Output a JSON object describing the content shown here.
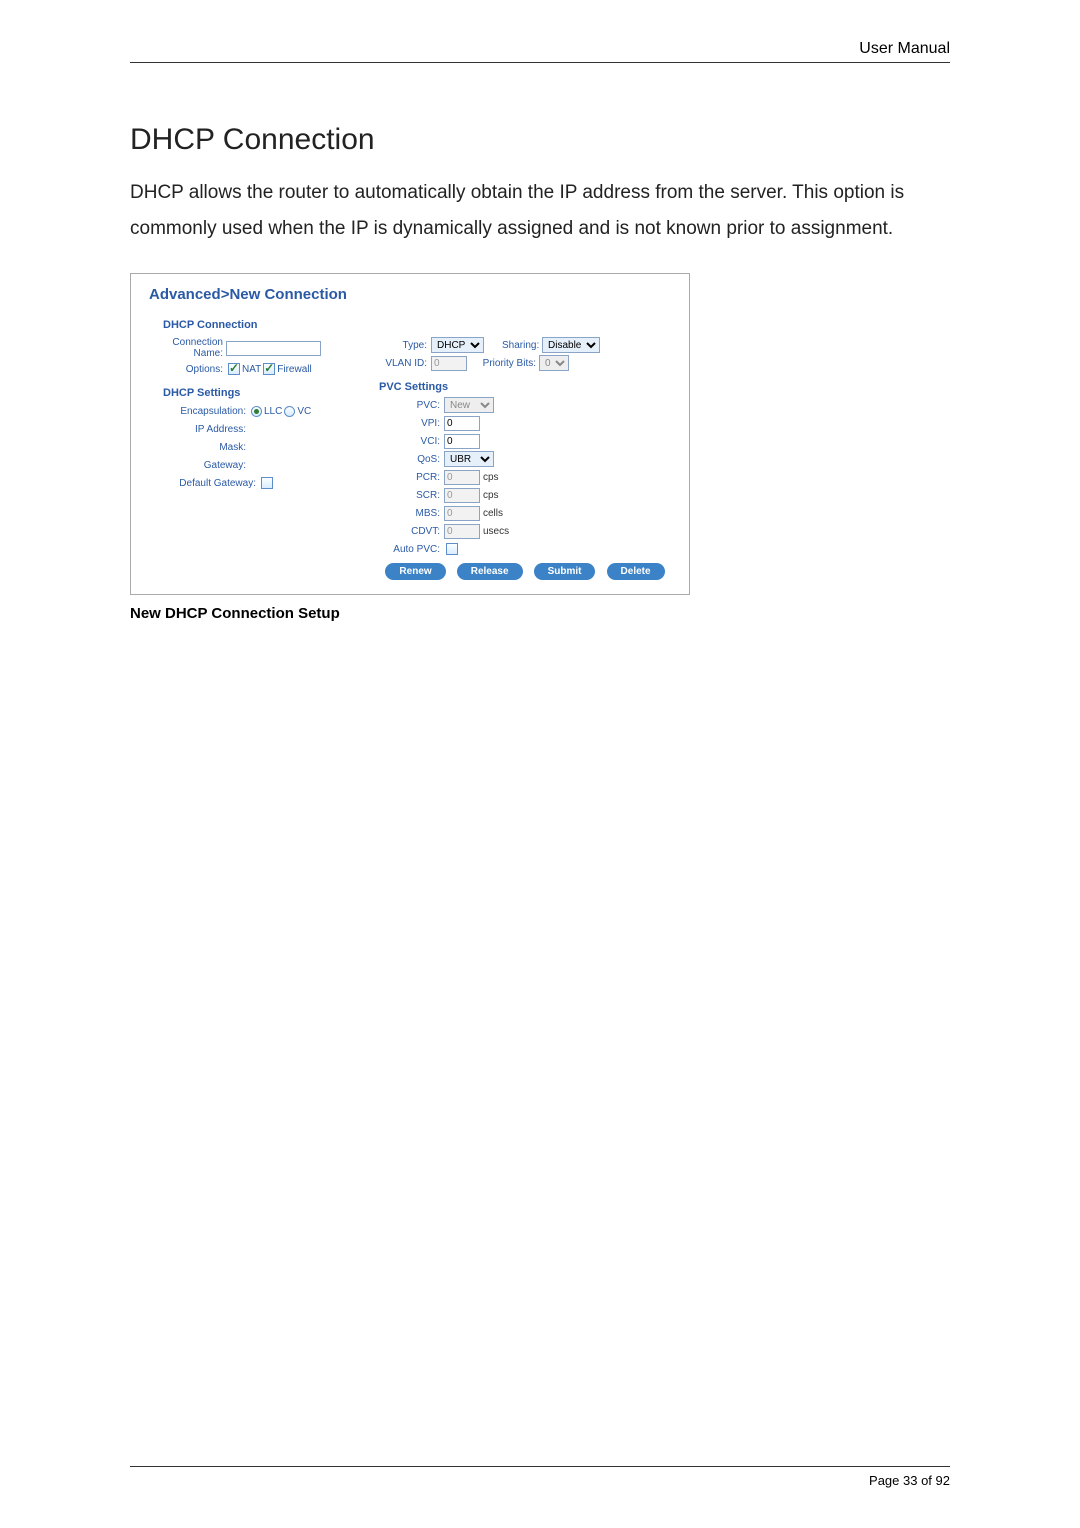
{
  "header": {
    "doc_label": "User Manual"
  },
  "section": {
    "title": "DHCP Connection",
    "description": "DHCP allows the router to automatically obtain the IP address from the server. This option is commonly used when the IP is dynamically assigned and is not known prior to assignment."
  },
  "panel": {
    "breadcrumb": "Advanced>New Connection",
    "heading": "DHCP Connection",
    "left": {
      "conn_name_label": "Connection Name:",
      "conn_name_value": "",
      "options_label": "Options:",
      "nat_label": "NAT",
      "firewall_label": "Firewall",
      "dhcp_settings_heading": "DHCP Settings",
      "encap_label": "Encapsulation:",
      "encap_llc": "LLC",
      "encap_vc": "VC",
      "ip_label": "IP Address:",
      "mask_label": "Mask:",
      "gateway_label": "Gateway:",
      "defgw_label": "Default Gateway:"
    },
    "right": {
      "type_label": "Type:",
      "type_value": "DHCP",
      "sharing_label": "Sharing:",
      "sharing_value": "Disable",
      "vlan_label": "VLAN ID:",
      "vlan_value": "0",
      "priority_label": "Priority Bits:",
      "priority_value": "0",
      "pvc_heading": "PVC Settings",
      "pvc_label": "PVC:",
      "pvc_value": "New",
      "vpi_label": "VPI:",
      "vpi_value": "0",
      "vci_label": "VCI:",
      "vci_value": "0",
      "qos_label": "QoS:",
      "qos_value": "UBR",
      "pcr_label": "PCR:",
      "pcr_value": "0",
      "pcr_unit": "cps",
      "scr_label": "SCR:",
      "scr_value": "0",
      "scr_unit": "cps",
      "mbs_label": "MBS:",
      "mbs_value": "0",
      "mbs_unit": "cells",
      "cdvt_label": "CDVT:",
      "cdvt_value": "0",
      "cdvt_unit": "usecs",
      "autopvc_label": "Auto PVC:"
    },
    "buttons": {
      "renew": "Renew",
      "release": "Release",
      "submit": "Submit",
      "delete": "Delete"
    }
  },
  "caption": "New DHCP Connection Setup",
  "footer": {
    "page_label": "Page 33 of 92"
  }
}
